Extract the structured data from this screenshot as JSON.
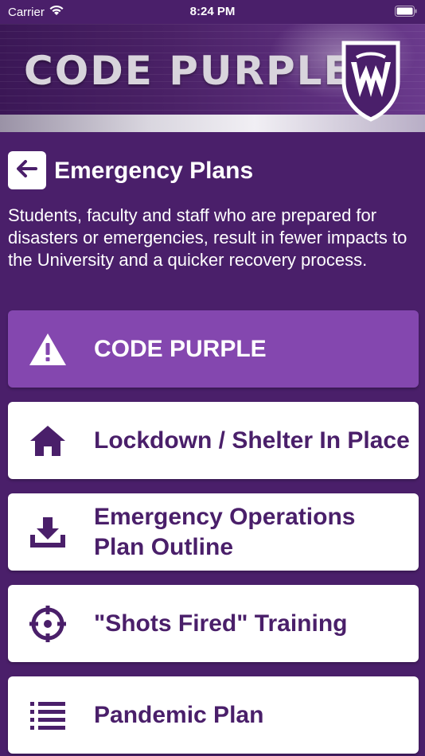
{
  "status_bar": {
    "carrier": "Carrier",
    "time": "8:24 PM"
  },
  "banner": {
    "title": "CODE PURPLE",
    "logo_icon": "university-shield-w-logo"
  },
  "header": {
    "back_icon": "arrow-left-icon",
    "title": "Emergency Plans"
  },
  "intro_text": "Students, faculty and staff who are prepared for disasters or emergencies, result in fewer impacts to the University and a quicker recovery process.",
  "menu": [
    {
      "label": "CODE PURPLE",
      "icon": "warning-triangle-icon",
      "highlighted": true
    },
    {
      "label": "Lockdown / Shelter In Place",
      "icon": "home-icon",
      "highlighted": false
    },
    {
      "label": "Emergency Operations Plan Outline",
      "icon": "download-icon",
      "highlighted": false
    },
    {
      "label": "\"Shots Fired\" Training",
      "icon": "crosshair-icon",
      "highlighted": false
    },
    {
      "label": "Pandemic Plan",
      "icon": "list-icon",
      "highlighted": false
    }
  ],
  "colors": {
    "background": "#4a1f6a",
    "accent": "#8447af",
    "card": "#ffffff",
    "text_dark": "#4a1f6a"
  }
}
